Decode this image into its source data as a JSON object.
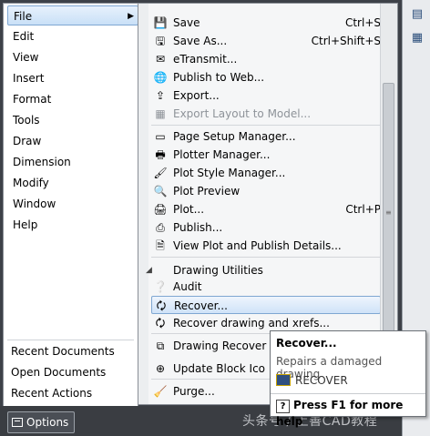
{
  "left_menu": {
    "items": [
      {
        "label": "File",
        "active": true
      },
      {
        "label": "Edit"
      },
      {
        "label": "View"
      },
      {
        "label": "Insert"
      },
      {
        "label": "Format"
      },
      {
        "label": "Tools"
      },
      {
        "label": "Draw"
      },
      {
        "label": "Dimension"
      },
      {
        "label": "Modify"
      },
      {
        "label": "Window"
      },
      {
        "label": "Help"
      }
    ],
    "bottom_items": [
      {
        "label": "Recent Documents"
      },
      {
        "label": "Open Documents"
      },
      {
        "label": "Recent Actions"
      }
    ]
  },
  "file_submenu": {
    "items": [
      {
        "label": "Save",
        "shortcut": "Ctrl+S",
        "icon": "save-icon"
      },
      {
        "label": "Save As...",
        "shortcut": "Ctrl+Shift+S",
        "icon": "save-as-icon"
      },
      {
        "label": "eTransmit...",
        "icon": "etransmit-icon"
      },
      {
        "label": "Publish to Web...",
        "icon": "publish-web-icon"
      },
      {
        "label": "Export...",
        "icon": "export-icon"
      },
      {
        "label": "Export Layout to Model...",
        "icon": "export-layout-icon",
        "disabled": true
      },
      {
        "label": "Page Setup Manager...",
        "icon": "page-setup-icon"
      },
      {
        "label": "Plotter Manager...",
        "icon": "plotter-icon"
      },
      {
        "label": "Plot Style Manager...",
        "icon": "plot-style-icon"
      },
      {
        "label": "Plot Preview",
        "icon": "plot-preview-icon"
      },
      {
        "label": "Plot...",
        "shortcut": "Ctrl+P",
        "icon": "plot-icon"
      },
      {
        "label": "Publish...",
        "icon": "publish-icon"
      },
      {
        "label": "View Plot and Publish Details...",
        "icon": "plot-details-icon"
      }
    ],
    "group_heading": "Drawing Utilities",
    "utilities": [
      {
        "label": "Audit",
        "icon": "audit-icon"
      },
      {
        "label": "Recover...",
        "icon": "recover-icon",
        "highlighted": true
      },
      {
        "label": "Recover drawing and xrefs...",
        "icon": "recover-xrefs-icon"
      },
      {
        "label": "Drawing Recover",
        "icon": "drawing-recover-icon"
      },
      {
        "label": "Update Block Ico",
        "icon": "update-block-icon"
      },
      {
        "label": "Purge...",
        "icon": "purge-icon"
      }
    ]
  },
  "tooltip": {
    "title": "Recover...",
    "description": "Repairs a damaged drawing",
    "command": "RECOVER",
    "help": "Press F1 for more help"
  },
  "options_button": "Options",
  "watermark": "头条号 / 上善CAD教程",
  "colors": {
    "highlight_border": "#7fa7d2",
    "highlight_fill": "#cfe3f8",
    "bottom_bar": "#3a3d42",
    "disabled_text": "#8e9399"
  }
}
